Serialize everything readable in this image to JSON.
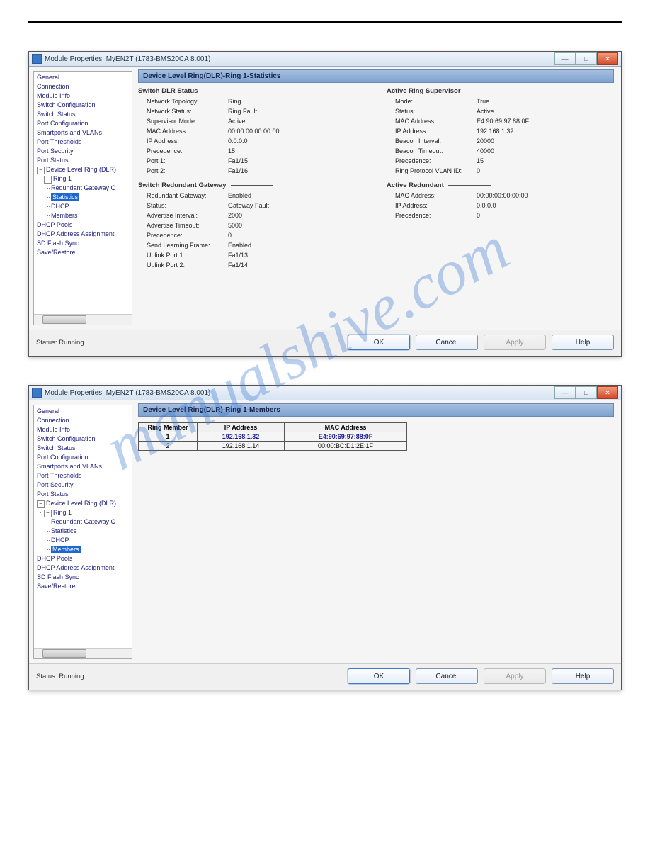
{
  "watermark": "manualshive.com",
  "dialog1": {
    "title": "Module Properties: MyEN2T (1783-BMS20CA 8.001)",
    "panel_title": "Device Level Ring(DLR)-Ring 1-Statistics",
    "tree": {
      "items": [
        "General",
        "Connection",
        "Module Info",
        "Switch Configuration",
        "Switch Status",
        "Port Configuration",
        "Smartports and VLANs",
        "Port Thresholds",
        "Port Security",
        "Port Status"
      ],
      "dlr_label": "Device Level Ring (DLR)",
      "ring_label": "Ring 1",
      "ring_children": [
        "Redundant Gateway C",
        "Statistics",
        "DHCP",
        "Members"
      ],
      "selected_index": 1,
      "tail": [
        "DHCP Pools",
        "DHCP Address Assignment",
        "SD Flash Sync",
        "Save/Restore"
      ],
      "exp_minus": "−",
      "exp_plus": "+"
    },
    "switch_dlr_header": "Switch DLR Status",
    "switch_dlr": [
      {
        "k": "Network Topology:",
        "v": "Ring"
      },
      {
        "k": "Network Status:",
        "v": "Ring Fault"
      },
      {
        "k": "Supervisor Mode:",
        "v": "Active"
      },
      {
        "k": "MAC Address:",
        "v": "00:00:00:00:00:00"
      },
      {
        "k": "IP Address:",
        "v": "0.0.0.0"
      },
      {
        "k": "Precedence:",
        "v": "15"
      },
      {
        "k": "Port 1:",
        "v": "Fa1/15"
      },
      {
        "k": "Port 2:",
        "v": "Fa1/16"
      }
    ],
    "active_supervisor_header": "Active Ring Supervisor",
    "active_supervisor": [
      {
        "k": "Mode:",
        "v": "True"
      },
      {
        "k": "Status:",
        "v": "Active"
      },
      {
        "k": "MAC Address:",
        "v": "E4:90:69:97:88:0F"
      },
      {
        "k": "IP Address:",
        "v": "192.168.1.32"
      },
      {
        "k": "Beacon Interval:",
        "v": "20000"
      },
      {
        "k": "Beacon Timeout:",
        "v": "40000"
      },
      {
        "k": "Precedence:",
        "v": "15"
      },
      {
        "k": "Ring Protocol VLAN ID:",
        "v": "0"
      }
    ],
    "redundant_gw_header": "Switch Redundant Gateway",
    "redundant_gw": [
      {
        "k": "Redundant Gateway:",
        "v": "Enabled"
      },
      {
        "k": "Status:",
        "v": "Gateway Fault"
      },
      {
        "k": "Advertise Interval:",
        "v": "2000"
      },
      {
        "k": "Advertise Timeout:",
        "v": "5000"
      },
      {
        "k": "Precedence:",
        "v": "0"
      },
      {
        "k": "Send Learning Frame:",
        "v": "Enabled"
      },
      {
        "k": "Uplink Port 1:",
        "v": "Fa1/13"
      },
      {
        "k": "Uplink Port 2:",
        "v": "Fa1/14"
      }
    ],
    "active_redundant_header": "Active Redundant",
    "active_redundant": [
      {
        "k": "MAC Address:",
        "v": "00:00:00:00:00:00"
      },
      {
        "k": "IP Address:",
        "v": "0.0.0.0"
      },
      {
        "k": "Precedence:",
        "v": "0"
      }
    ],
    "status_label": "Status:",
    "status_value": "Running",
    "buttons": {
      "ok": "OK",
      "cancel": "Cancel",
      "apply": "Apply",
      "help": "Help"
    }
  },
  "dialog2": {
    "title": "Module Properties: MyEN2T (1783-BMS20CA 8.001)",
    "panel_title": "Device Level Ring(DLR)-Ring 1-Members",
    "tree": {
      "items": [
        "General",
        "Connection",
        "Module Info",
        "Switch Configuration",
        "Switch Status",
        "Port Configuration",
        "Smartports and VLANs",
        "Port Thresholds",
        "Port Security",
        "Port Status"
      ],
      "dlr_label": "Device Level Ring (DLR)",
      "ring_label": "Ring 1",
      "ring_children": [
        "Redundant Gateway C",
        "Statistics",
        "DHCP",
        "Members"
      ],
      "selected_index": 3,
      "tail": [
        "DHCP Pools",
        "DHCP Address Assignment",
        "SD Flash Sync",
        "Save/Restore"
      ],
      "exp_minus": "−"
    },
    "table": {
      "headers": [
        "Ring Member",
        "IP Address",
        "MAC Address"
      ],
      "rows": [
        {
          "n": "1",
          "ip": "192.168.1.32",
          "mac": "E4:90:69:97:88:0F",
          "hl": true
        },
        {
          "n": "2",
          "ip": "192.168.1.14",
          "mac": "00:00:BC:D1:2E:1F",
          "hl": false
        }
      ]
    },
    "status_label": "Status:",
    "status_value": "Running",
    "buttons": {
      "ok": "OK",
      "cancel": "Cancel",
      "apply": "Apply",
      "help": "Help"
    }
  },
  "win_controls": {
    "min": "—",
    "max": "□",
    "close": "✕"
  }
}
